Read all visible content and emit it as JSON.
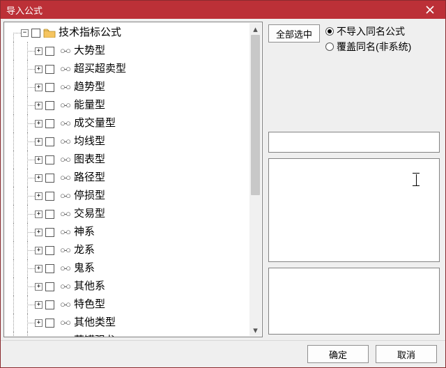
{
  "window": {
    "title": "导入公式"
  },
  "tree": {
    "root": {
      "label": "技术指标公式",
      "expanded": true
    },
    "items": [
      {
        "label": "大势型"
      },
      {
        "label": "超买超卖型"
      },
      {
        "label": "趋势型"
      },
      {
        "label": "能量型"
      },
      {
        "label": "成交量型"
      },
      {
        "label": "均线型"
      },
      {
        "label": "图表型"
      },
      {
        "label": "路径型"
      },
      {
        "label": "停损型"
      },
      {
        "label": "交易型"
      },
      {
        "label": "神系"
      },
      {
        "label": "龙系"
      },
      {
        "label": "鬼系"
      },
      {
        "label": "其他系"
      },
      {
        "label": "特色型"
      },
      {
        "label": "其他类型"
      },
      {
        "label": "蓄罐强龙"
      }
    ]
  },
  "actions": {
    "select_all": "全部选中",
    "ok": "确定",
    "cancel": "取消"
  },
  "options": {
    "skip_same_name": "不导入同名公式",
    "overwrite_nonsys": "覆盖同名(非系统)",
    "selected": "skip_same_name"
  },
  "glyphs": {
    "plus": "+",
    "minus": "−"
  }
}
